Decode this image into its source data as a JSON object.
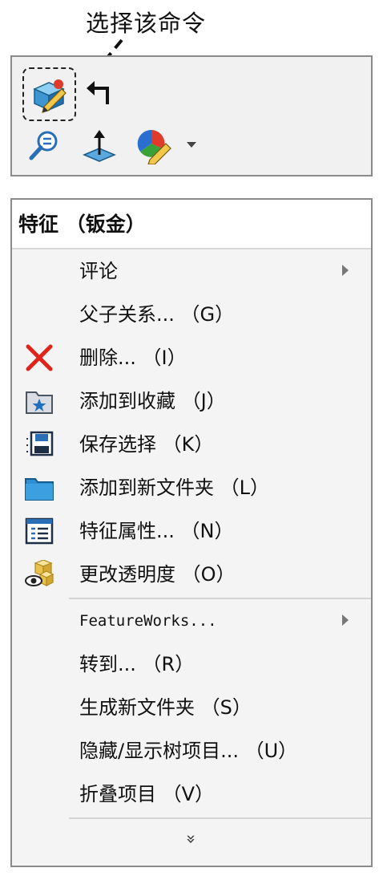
{
  "callout": {
    "text": "选择该命令"
  },
  "toolbar": {
    "edit_appearance_icon": "edit-appearance-icon",
    "return_icon": "return-arrow-icon",
    "zoom_icon": "zoom-to-selection-icon",
    "normal_to_icon": "normal-to-icon",
    "appearance_icon": "appearance-icon",
    "dropdown_icon": "dropdown-arrow-icon"
  },
  "menu": {
    "header": "特征 （钣金）",
    "items": [
      {
        "label": "评论",
        "icon": "",
        "submenu": true
      },
      {
        "label": "父子关系... （G）",
        "icon": ""
      },
      {
        "label": "删除... （I）",
        "icon": "delete-x-icon"
      },
      {
        "label": "添加到收藏 （J）",
        "icon": "favorite-folder-icon"
      },
      {
        "label": "保存选择 （K）",
        "icon": "save-selection-icon"
      },
      {
        "label": "添加到新文件夹 （L）",
        "icon": "new-folder-icon"
      },
      {
        "label": "特征属性... （N）",
        "icon": "feature-properties-icon"
      },
      {
        "label": "更改透明度 （O）",
        "icon": "transparency-icon"
      },
      {
        "label": "FeatureWorks...",
        "icon": "",
        "submenu": true
      },
      {
        "label": "转到... （R）",
        "icon": ""
      },
      {
        "label": "生成新文件夹 （S）",
        "icon": ""
      },
      {
        "label": "隐藏/显示树项目... （U）",
        "icon": ""
      },
      {
        "label": "折叠项目 （V）",
        "icon": ""
      }
    ],
    "more_glyph": "»"
  },
  "colors": {
    "delete_red": "#e0241b",
    "folder_blue": "#2f8fd3",
    "toolbar_bg": "#f1f1f1",
    "menu_bg": "#f4f4f4"
  }
}
